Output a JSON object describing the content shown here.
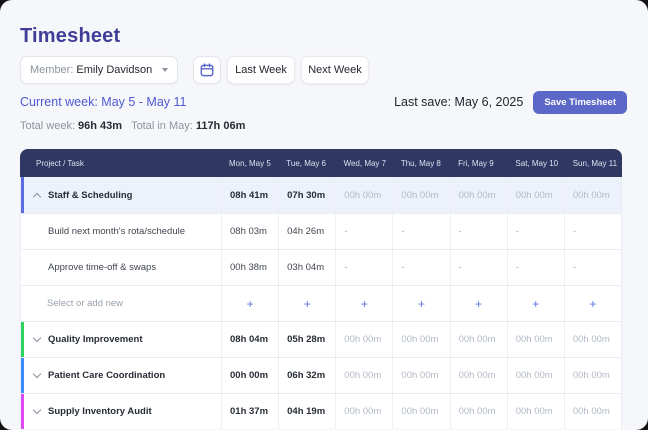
{
  "page": {
    "title": "Timesheet"
  },
  "toolbar": {
    "member_label": "Member:",
    "member_value": "Emily Davidson",
    "last_week": "Last Week",
    "next_week": "Next Week"
  },
  "week": {
    "current_week": "Current week: May 5 - May 11",
    "last_save_label": "Last save:",
    "last_save_value": "May 6, 2025",
    "save_button": "Save Timesheet"
  },
  "totals": {
    "week_label": "Total week:",
    "week_value": "96h 43m",
    "may_label": "Total in May:",
    "may_value": "117h 06m"
  },
  "colors": {
    "accent": "#5c68c7",
    "header_bg": "#2e3862",
    "staff_bar": "#5a6ce0",
    "quality_bar": "#2fd15f",
    "patient_bar": "#3e8bfd",
    "supply_bar": "#dd49f2"
  },
  "table": {
    "task_header": "Project / Task",
    "day_headers": [
      "Mon, May 5",
      "Tue, May 6",
      "Wed, May 7",
      "Thu, May 8",
      "Fri, May 9",
      "Sat, May 10",
      "Sun, May 11"
    ],
    "rows": [
      {
        "type": "group",
        "expanded": true,
        "bar": "#5a6ce0",
        "label": "Staff & Scheduling",
        "cells": [
          {
            "text": "08h 41m",
            "style": "strong"
          },
          {
            "text": "07h 30m",
            "style": "strong"
          },
          {
            "text": "00h 00m",
            "style": "muted"
          },
          {
            "text": "00h 00m",
            "style": "muted"
          },
          {
            "text": "00h 00m",
            "style": "muted"
          },
          {
            "text": "00h 00m",
            "style": "muted"
          },
          {
            "text": "00h 00m",
            "style": "muted"
          }
        ]
      },
      {
        "type": "child",
        "label": "Build next month's rota/schedule",
        "cells": [
          {
            "text": "08h 03m",
            "style": "normal"
          },
          {
            "text": "04h 26m",
            "style": "normal"
          },
          {
            "text": "-",
            "style": "dash"
          },
          {
            "text": "-",
            "style": "dash"
          },
          {
            "text": "-",
            "style": "dash"
          },
          {
            "text": "-",
            "style": "dash"
          },
          {
            "text": "-",
            "style": "dash"
          }
        ]
      },
      {
        "type": "child",
        "label": "Approve time-off & swaps",
        "cells": [
          {
            "text": "00h 38m",
            "style": "normal"
          },
          {
            "text": "03h 04m",
            "style": "normal"
          },
          {
            "text": "-",
            "style": "dash"
          },
          {
            "text": "-",
            "style": "dash"
          },
          {
            "text": "-",
            "style": "dash"
          },
          {
            "text": "-",
            "style": "dash"
          },
          {
            "text": "-",
            "style": "dash"
          }
        ]
      },
      {
        "type": "add",
        "label": "Select or add new",
        "plus": "+"
      },
      {
        "type": "group",
        "expanded": false,
        "bar": "#2fd15f",
        "label": "Quality Improvement",
        "cells": [
          {
            "text": "08h 04m",
            "style": "strong"
          },
          {
            "text": "05h 28m",
            "style": "strong"
          },
          {
            "text": "00h 00m",
            "style": "muted"
          },
          {
            "text": "00h 00m",
            "style": "muted"
          },
          {
            "text": "00h 00m",
            "style": "muted"
          },
          {
            "text": "00h 00m",
            "style": "muted"
          },
          {
            "text": "00h 00m",
            "style": "muted"
          }
        ]
      },
      {
        "type": "group",
        "expanded": false,
        "bar": "#3e8bfd",
        "label": "Patient Care Coordination",
        "cells": [
          {
            "text": "00h 00m",
            "style": "strong"
          },
          {
            "text": "06h 32m",
            "style": "strong"
          },
          {
            "text": "00h 00m",
            "style": "muted"
          },
          {
            "text": "00h 00m",
            "style": "muted"
          },
          {
            "text": "00h 00m",
            "style": "muted"
          },
          {
            "text": "00h 00m",
            "style": "muted"
          },
          {
            "text": "00h 00m",
            "style": "muted"
          }
        ]
      },
      {
        "type": "group",
        "expanded": false,
        "bar": "#dd49f2",
        "label": "Supply Inventory Audit",
        "cells": [
          {
            "text": "01h 37m",
            "style": "strong"
          },
          {
            "text": "04h 19m",
            "style": "strong"
          },
          {
            "text": "00h 00m",
            "style": "muted"
          },
          {
            "text": "00h 00m",
            "style": "muted"
          },
          {
            "text": "00h 00m",
            "style": "muted"
          },
          {
            "text": "00h 00m",
            "style": "muted"
          },
          {
            "text": "00h 00m",
            "style": "muted"
          }
        ]
      }
    ]
  }
}
